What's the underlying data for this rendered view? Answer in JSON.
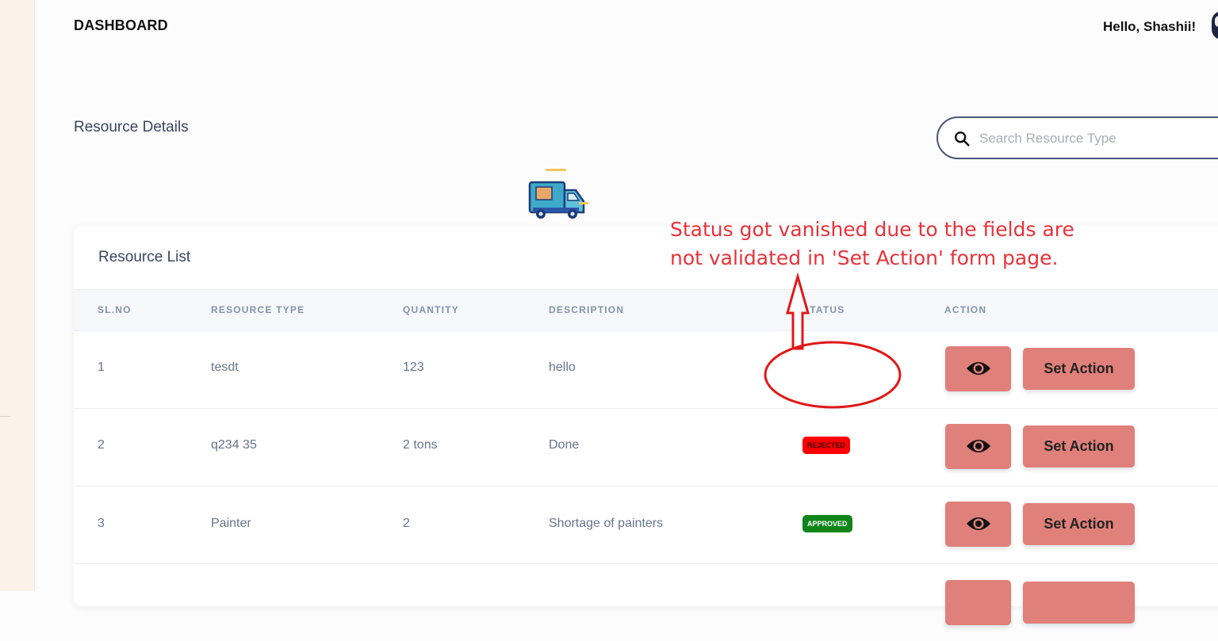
{
  "header": {
    "title": "DASHBOARD",
    "greeting": "Hello, Shashii!"
  },
  "page": {
    "heading": "Resource Details"
  },
  "search": {
    "placeholder": "Search Resource Type",
    "icon": "search-icon"
  },
  "card": {
    "title": "Resource List",
    "columns": [
      "SL.NO",
      "RESOURCE TYPE",
      "QUANTITY",
      "DESCRIPTION",
      "STATUS",
      "ACTION"
    ],
    "rows": [
      {
        "slno": "1",
        "type": "tesdt",
        "quantity": "123",
        "description": "hello",
        "status": ""
      },
      {
        "slno": "2",
        "type": "q234 35",
        "quantity": "2 tons",
        "description": "Done",
        "status": "REJECTED"
      },
      {
        "slno": "3",
        "type": "Painter",
        "quantity": "2",
        "description": "Shortage of painters",
        "status": "APPROVED"
      }
    ],
    "action_label": "Set Action",
    "view_icon": "eye-icon"
  },
  "annotation": {
    "text_line1": "Status got vanished due to the fields are",
    "text_line2": "not validated in 'Set Action' form page."
  },
  "colors": {
    "button": "#e0807a",
    "rejected": "#ff0000",
    "approved": "#10861a",
    "annotation": "#e8323a"
  }
}
